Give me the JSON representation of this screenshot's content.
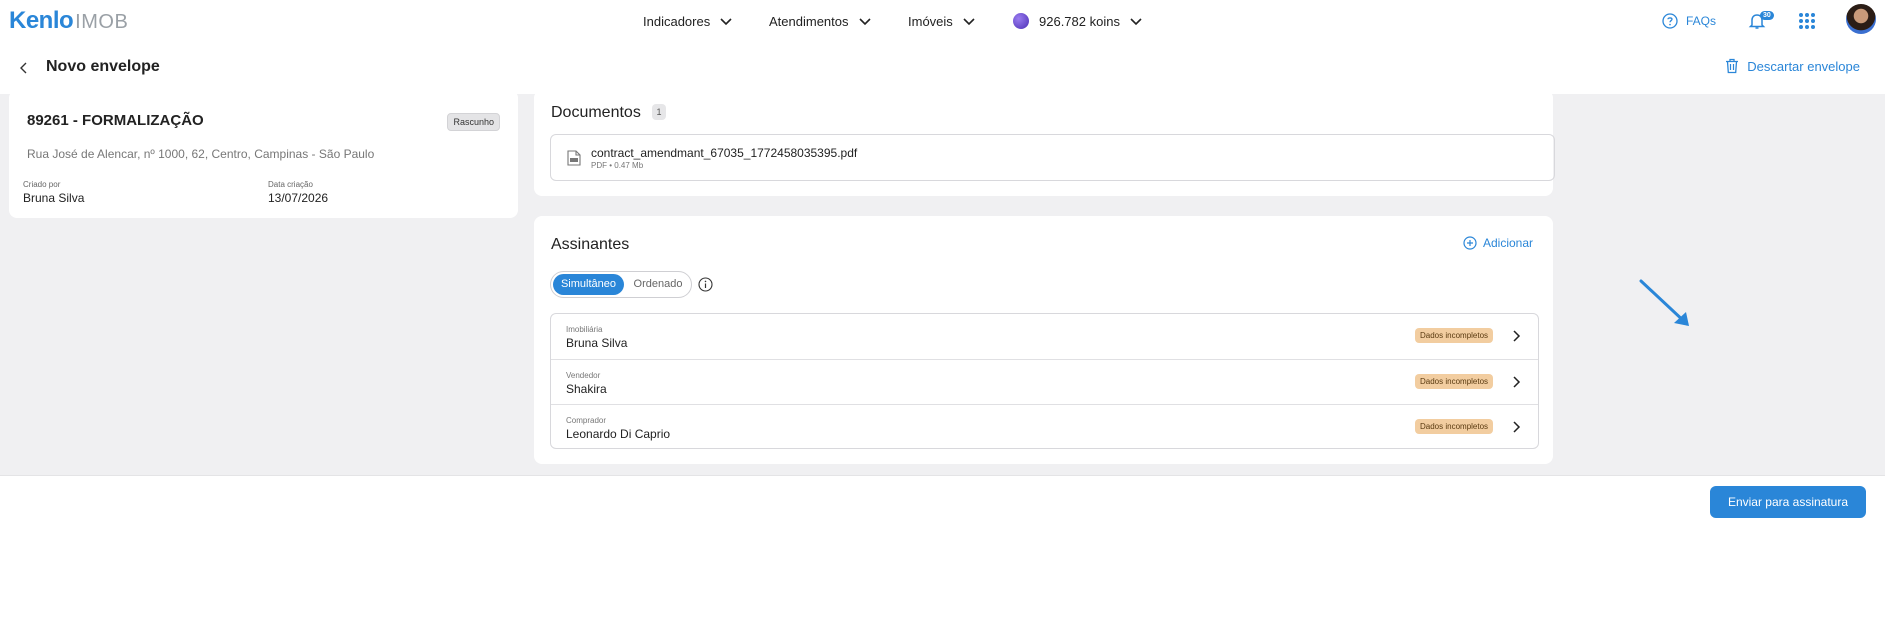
{
  "app": {
    "logo_brand": "Kenlo",
    "logo_sub": "IMOB"
  },
  "topnav": {
    "items": [
      {
        "label": "Indicadores"
      },
      {
        "label": "Atendimentos"
      },
      {
        "label": "Imóveis"
      }
    ],
    "koins": "926.782 koins",
    "faq_label": "FAQs",
    "notifications_count": "30"
  },
  "header": {
    "title": "Novo envelope",
    "discard_label": "Descartar envelope"
  },
  "envelope": {
    "title": "89261 - FORMALIZAÇÃO",
    "status": "Rascunho",
    "address": "Rua José de Alencar, nº 1000, 62, Centro, Campinas - São Paulo",
    "created_by_label": "Criado por",
    "created_by": "Bruna Silva",
    "created_date_label": "Data criação",
    "created_date": "13/07/2026"
  },
  "documents": {
    "title": "Documentos",
    "count": "1",
    "items": [
      {
        "name": "contract_amendmant_67035_1772458035395.pdf",
        "meta": "PDF • 0.47 Mb"
      }
    ]
  },
  "signers": {
    "title": "Assinantes",
    "add_label": "Adicionar",
    "mode_simultaneous": "Simultâneo",
    "mode_ordered": "Ordenado",
    "rows": [
      {
        "role": "Imobiliária",
        "name": "Bruna Silva",
        "status": "Dados incompletos"
      },
      {
        "role": "Vendedor",
        "name": "Shakira",
        "status": "Dados incompletos"
      },
      {
        "role": "Comprador",
        "name": "Leonardo Di Caprio",
        "status": "Dados incompletos"
      }
    ]
  },
  "footer": {
    "send_label": "Enviar para assinatura"
  },
  "colors": {
    "accent": "#2a86d8",
    "warning_badge": "#f2cda0",
    "background": "#f0f0f2"
  }
}
